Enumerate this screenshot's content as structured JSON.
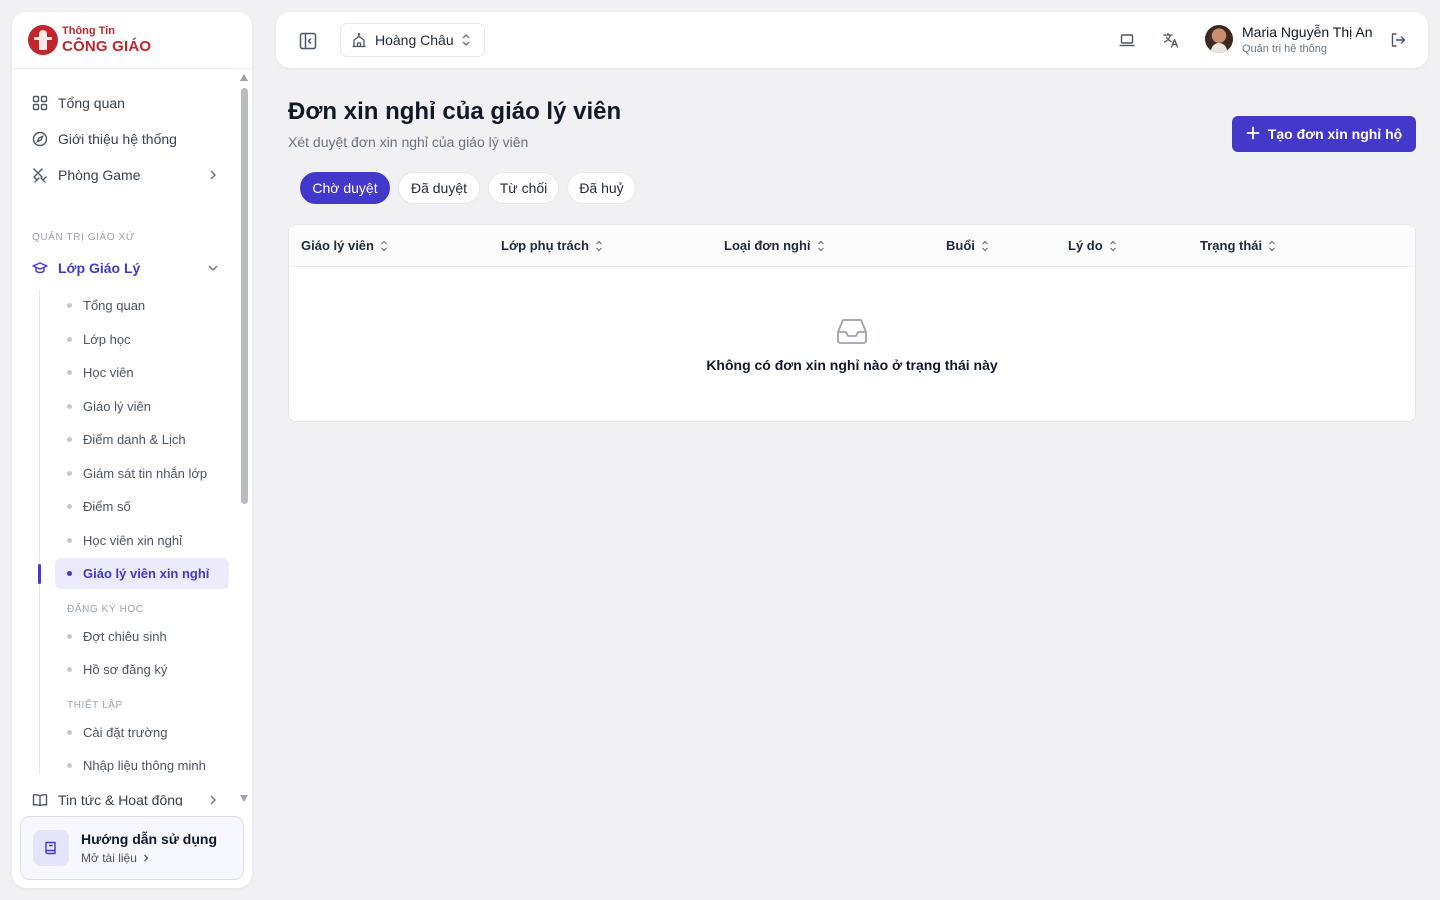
{
  "brand": {
    "line1": "Thông Tin",
    "line2": "CÔNG GIÁO"
  },
  "sidebar": {
    "top_items": [
      {
        "label": "Tổng quan",
        "icon": "grid-icon"
      },
      {
        "label": "Giới thiệu hệ thống",
        "icon": "compass-icon"
      },
      {
        "label": "Phòng Game",
        "icon": "swords-icon"
      }
    ],
    "section_admin": "QUẢN TRỊ GIÁO XỨ",
    "catechism": {
      "label": "Lớp Giáo Lý",
      "items": [
        "Tổng quan",
        "Lớp học",
        "Học viên",
        "Giáo lý viên",
        "Điểm danh & Lịch",
        "Giám sát tin nhắn lớp",
        "Điểm số",
        "Học viên xin nghỉ",
        "Giáo lý viên xin nghỉ"
      ],
      "active_item": "Giáo lý viên xin nghỉ",
      "enroll_label": "ĐĂNG KÝ HỌC",
      "enroll_items": [
        "Đợt chiêu sinh",
        "Hồ sơ đăng ký"
      ],
      "settings_label": "THIẾT LẬP",
      "settings_items": [
        "Cài đặt trường",
        "Nhập liệu thông minh"
      ]
    },
    "news": {
      "label": "Tin tức & Hoạt động",
      "icon": "book-open-icon"
    },
    "guide": {
      "title": "Hướng dẫn sử dụng",
      "subtitle": "Mở tài liệu"
    }
  },
  "topbar": {
    "parish": "Hoàng Châu",
    "user_name": "Maria Nguyễn Thị An",
    "user_role": "Quản trị hệ thống"
  },
  "main": {
    "title": "Đơn xin nghỉ của giáo lý viên",
    "subtitle": "Xét duyệt đơn xin nghỉ của giáo lý viên",
    "create_button": "Tạo đơn xin nghỉ hộ",
    "tabs": [
      {
        "label": "Chờ duyệt",
        "active": true
      },
      {
        "label": "Đã duyệt",
        "active": false
      },
      {
        "label": "Từ chối",
        "active": false
      },
      {
        "label": "Đã huỷ",
        "active": false
      }
    ],
    "columns": [
      "Giáo lý viên",
      "Lớp phụ trách",
      "Loại đơn nghỉ",
      "Buổi",
      "Lý do",
      "Trạng thái"
    ],
    "empty_text": "Không có đơn xin nghỉ nào ở trạng thái này"
  },
  "colors": {
    "accent": "#4338ca",
    "brand_red": "#c0262c"
  }
}
